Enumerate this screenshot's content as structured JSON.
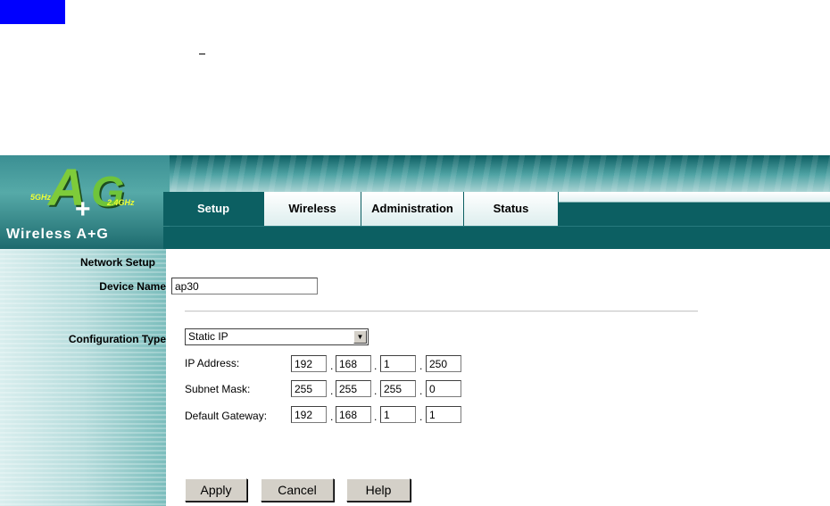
{
  "logo": {
    "ghz5": "5GHz",
    "letter_a": "A",
    "plus": "+",
    "letter_g": "G",
    "ghz24": "2.4GHz",
    "text": "Wireless A+G"
  },
  "tabs": [
    {
      "label": "Setup",
      "active": true
    },
    {
      "label": "Wireless",
      "active": false
    },
    {
      "label": "Administration",
      "active": false
    },
    {
      "label": "Status",
      "active": false
    }
  ],
  "subnav": "Network Setup",
  "section_title": "Network Setup",
  "device_name": {
    "label": "Device Name",
    "value": "ap30"
  },
  "config_type": {
    "label": "Configuration Type",
    "selected": "Static IP"
  },
  "ip_address": {
    "label": "IP Address:",
    "octets": [
      "192",
      "168",
      "1",
      "250"
    ]
  },
  "subnet_mask": {
    "label": "Subnet Mask:",
    "octets": [
      "255",
      "255",
      "255",
      "0"
    ]
  },
  "default_gateway": {
    "label": "Default Gateway:",
    "octets": [
      "192",
      "168",
      "1",
      "1"
    ]
  },
  "buttons": {
    "apply": "Apply",
    "cancel": "Cancel",
    "help": "Help"
  },
  "colors": {
    "accent": "#0c5f62",
    "top_box": "#0000ff"
  },
  "icons": {
    "dropdown": "chevron-down-icon"
  }
}
